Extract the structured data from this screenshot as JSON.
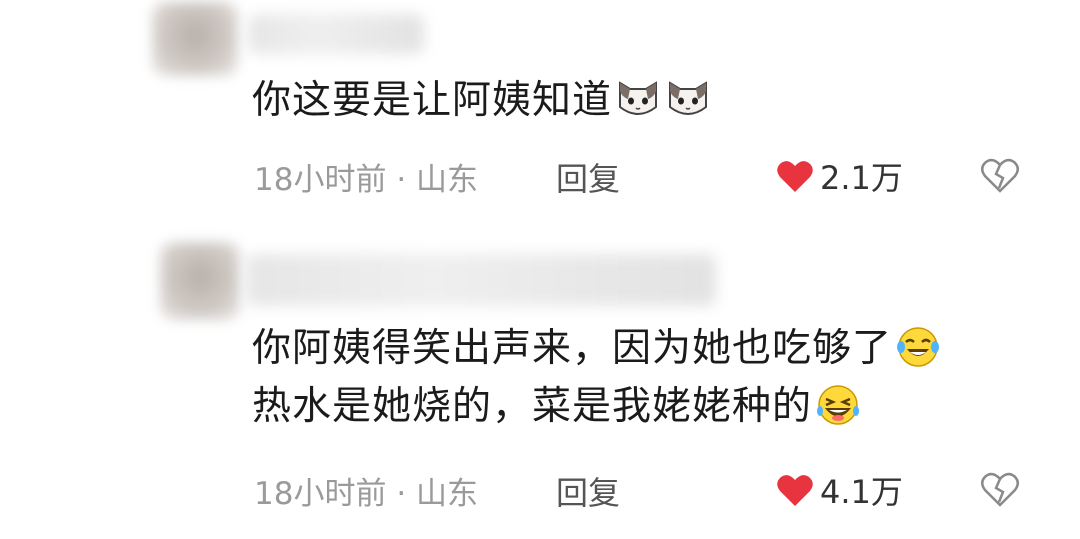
{
  "comments": [
    {
      "text": "你这要是让阿姨知道",
      "emojis": [
        "cat-face-icon",
        "cat-face-icon"
      ],
      "time": "18小时前",
      "separator": "·",
      "location": "山东",
      "reply_label": "回复",
      "likes": "2.1万"
    },
    {
      "line1": "你阿姨得笑出声来，因为她也吃够了",
      "line2": "热水是她烧的，菜是我姥姥种的",
      "emojis": [
        "crying-laughing-emoji-icon",
        "laughing-emoji-icon"
      ],
      "time": "18小时前",
      "separator": "·",
      "location": "山东",
      "reply_label": "回复",
      "likes": "4.1万"
    }
  ],
  "colors": {
    "heart": "#e8343f",
    "meta": "#9a9a9a",
    "text": "#1b1b1b"
  }
}
